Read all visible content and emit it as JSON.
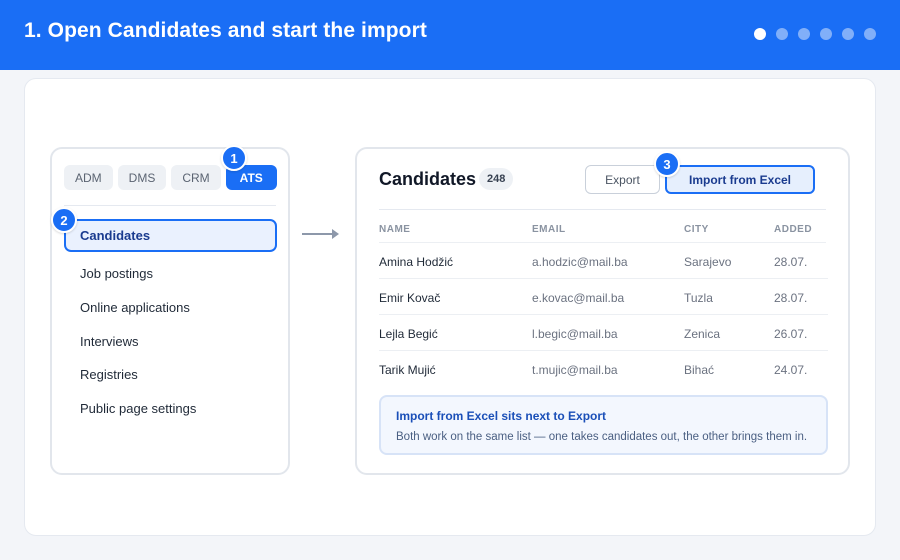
{
  "header": {
    "title": "1. Open Candidates and start the import",
    "steps_total": 6,
    "active_step": 1
  },
  "sidebar": {
    "tabs": [
      "ADM",
      "DMS",
      "CRM",
      "ATS"
    ],
    "active_tab": "ATS",
    "items": [
      {
        "label": "Candidates",
        "active": true
      },
      {
        "label": "Job postings"
      },
      {
        "label": "Online applications"
      },
      {
        "label": "Interviews"
      },
      {
        "label": "Registries"
      },
      {
        "label": "Public page settings"
      }
    ]
  },
  "badges": {
    "one": "1",
    "two": "2",
    "three": "3"
  },
  "panel": {
    "title": "Candidates",
    "count": "248",
    "export_label": "Export",
    "import_label": "Import from Excel",
    "columns": [
      "NAME",
      "EMAIL",
      "CITY",
      "ADDED"
    ],
    "rows": [
      {
        "name": "Amina Hodžić",
        "email": "a.hodzic@mail.ba",
        "city": "Sarajevo",
        "added": "28.07."
      },
      {
        "name": "Emir Kovač",
        "email": "e.kovac@mail.ba",
        "city": "Tuzla",
        "added": "28.07."
      },
      {
        "name": "Lejla Begić",
        "email": "l.begic@mail.ba",
        "city": "Zenica",
        "added": "26.07."
      },
      {
        "name": "Tarik Mujić",
        "email": "t.mujic@mail.ba",
        "city": "Bihać",
        "added": "24.07."
      }
    ],
    "note": {
      "title": "Import from Excel sits next to Export",
      "body": "Both work on the same list — one takes candidates out, the other brings them in."
    }
  },
  "colors": {
    "accent": "#1a6ef5",
    "header_bg": "#1a6ef5"
  }
}
